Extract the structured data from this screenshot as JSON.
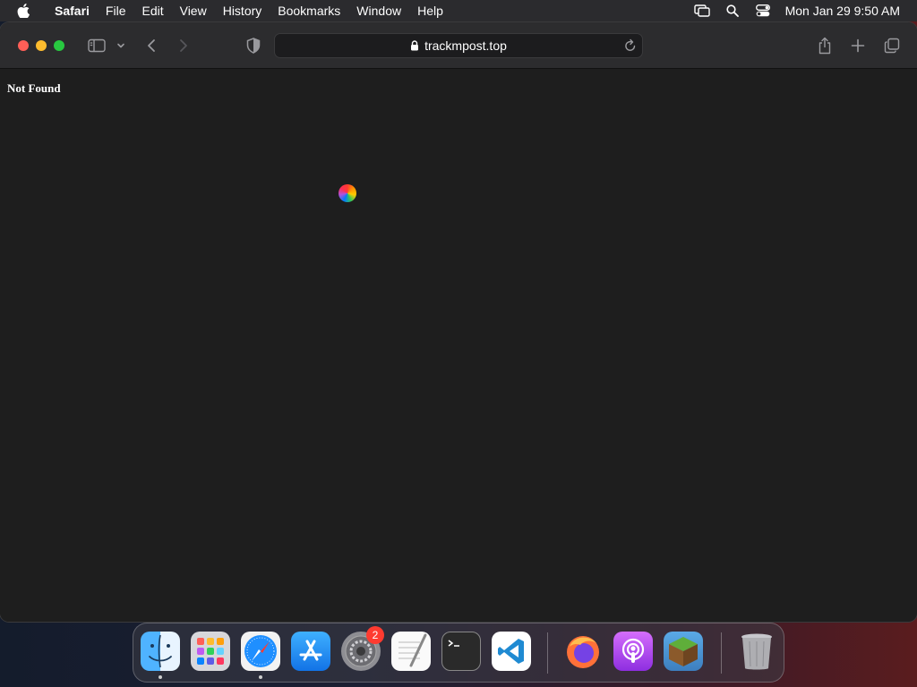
{
  "menubar": {
    "app_name": "Safari",
    "items": [
      "File",
      "Edit",
      "View",
      "History",
      "Bookmarks",
      "Window",
      "Help"
    ],
    "clock": "Mon Jan 29  9:50 AM"
  },
  "browser": {
    "url": "trackmpost.top"
  },
  "page": {
    "text": "Not Found"
  },
  "dock": {
    "items": [
      "finder-icon",
      "launchpad-icon",
      "safari-icon",
      "app-store-icon",
      "system-preferences-icon",
      "textedit-icon",
      "terminal-icon",
      "vscode-icon",
      "firefox-icon",
      "podcasts-icon",
      "minecraft-icon",
      "trash-icon"
    ],
    "system_preferences_badge": "2"
  },
  "colors": {
    "close": "#ff5f57",
    "minimize": "#febc2e",
    "maximize": "#28c840",
    "badge": "#ff3b30"
  }
}
